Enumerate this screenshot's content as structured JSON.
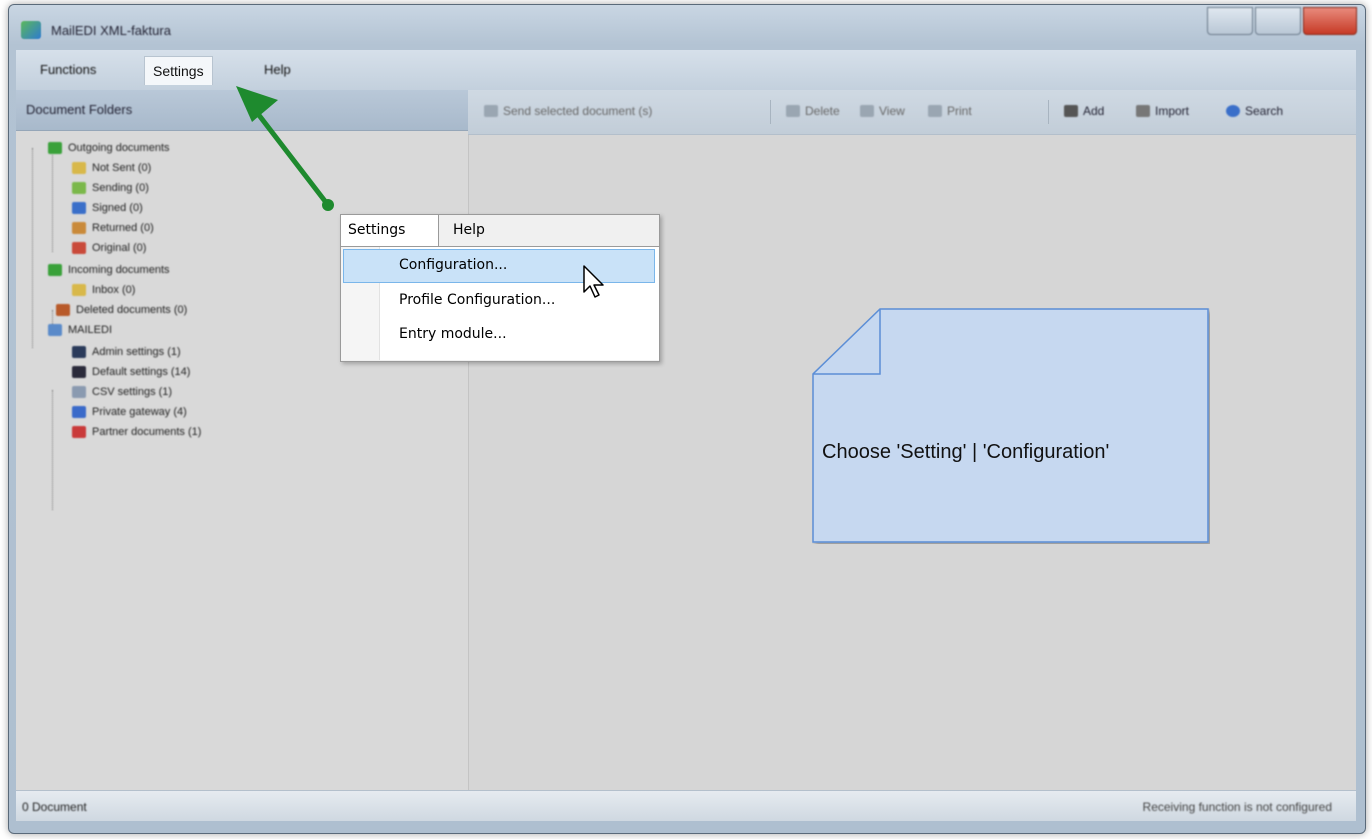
{
  "window": {
    "title": "MailEDI XML-faktura"
  },
  "menubar": {
    "items": [
      "Functions",
      "Settings",
      "Help"
    ]
  },
  "sidebar": {
    "header": "Document Folders",
    "tree": [
      {
        "label": "Outgoing documents",
        "color": "#3aa13a"
      },
      {
        "label": "Not Sent (0)",
        "color": "#d8b84a"
      },
      {
        "label": "Sending (0)",
        "color": "#7bb84a"
      },
      {
        "label": "Signed (0)",
        "color": "#3a6fc9"
      },
      {
        "label": "Returned (0)",
        "color": "#c98a3a"
      },
      {
        "label": "Original (0)",
        "color": "#c94a3a"
      },
      {
        "label": "Incoming documents",
        "color": "#3aa13a"
      },
      {
        "label": "Inbox (0)",
        "color": "#d8b84a"
      },
      {
        "label": "Deleted documents (0)",
        "color": "#b85a2a"
      },
      {
        "label": "MAILEDI",
        "color": "#5a8ac9"
      },
      {
        "label": "Admin settings (1)",
        "color": "#2a3a5a"
      },
      {
        "label": "Default settings (14)",
        "color": "#2a2a3a"
      },
      {
        "label": "CSV settings (1)",
        "color": "#8a9ab0"
      },
      {
        "label": "Private gateway (4)",
        "color": "#3a6ac9"
      },
      {
        "label": "Partner documents (1)",
        "color": "#c93a3a"
      }
    ]
  },
  "toolbar": {
    "send": "Send selected document (s)",
    "delete": "Delete",
    "view": "View",
    "print": "Print",
    "add": "Add",
    "import": "Import",
    "search": "Search"
  },
  "dropdown": {
    "tab_settings": "Settings",
    "tab_help": "Help",
    "items": [
      "Configuration...",
      "Profile Configuration...",
      "Entry module..."
    ]
  },
  "note": {
    "text": "Choose 'Setting' | 'Configuration'",
    "fill": "#c6d8f0",
    "border": "#5b8ed6"
  },
  "statusbar": {
    "left": "0 Document",
    "right": "Receiving function is not configured"
  },
  "colors": {
    "arrow": "#1e8a2e",
    "highlight": "#c9e2f8"
  }
}
